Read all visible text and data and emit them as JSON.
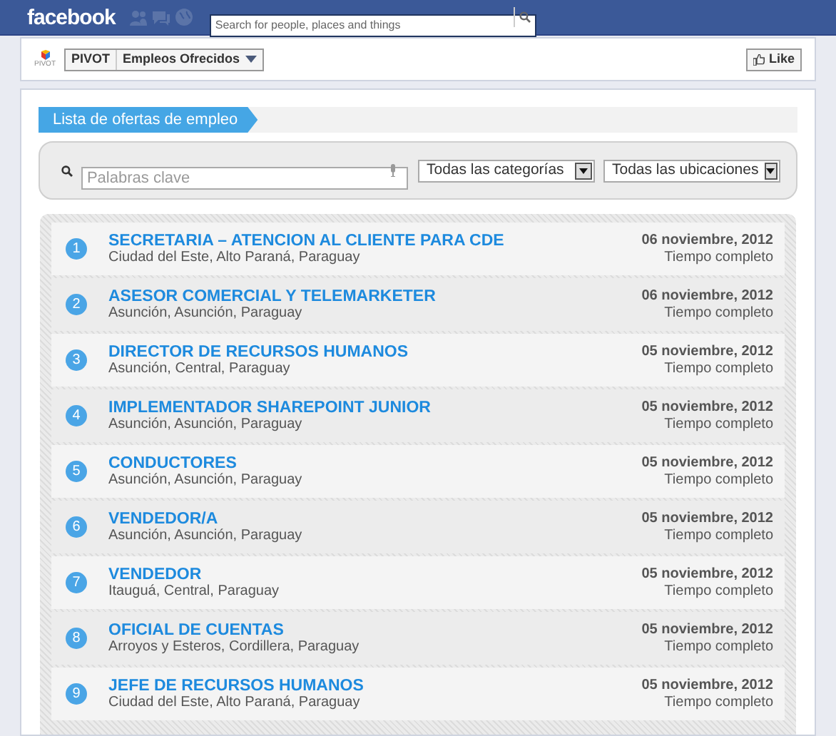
{
  "topbar": {
    "logo": "facebook",
    "search": {
      "placeholder": "Search for people, places and things"
    }
  },
  "page_header": {
    "brand": "PIVOT",
    "breadcrumb": [
      "PIVOT",
      "Empleos Ofrecidos"
    ],
    "like_button": "Like"
  },
  "section_title": "Lista de ofertas de empleo",
  "filters": {
    "keywords": {
      "placeholder": "Palabras clave"
    },
    "category": "Todas las categorías",
    "location": "Todas las ubicaciones"
  },
  "jobs": [
    {
      "number": "1",
      "title": "SECRETARIA – ATENCION AL CLIENTE PARA CDE",
      "location": "Ciudad del Este, Alto Paraná, Paraguay",
      "date": "06 noviembre, 2012",
      "type": "Tiempo completo"
    },
    {
      "number": "2",
      "title": "ASESOR COMERCIAL Y TELEMARKETER",
      "location": "Asunción, Asunción, Paraguay",
      "date": "06 noviembre, 2012",
      "type": "Tiempo completo"
    },
    {
      "number": "3",
      "title": "DIRECTOR DE RECURSOS HUMANOS",
      "location": "Asunción, Central, Paraguay",
      "date": "05 noviembre, 2012",
      "type": "Tiempo completo"
    },
    {
      "number": "4",
      "title": "IMPLEMENTADOR SHAREPOINT JUNIOR",
      "location": "Asunción, Asunción, Paraguay",
      "date": "05 noviembre, 2012",
      "type": "Tiempo completo"
    },
    {
      "number": "5",
      "title": "CONDUCTORES",
      "location": "Asunción, Asunción, Paraguay",
      "date": "05 noviembre, 2012",
      "type": "Tiempo completo"
    },
    {
      "number": "6",
      "title": "VENDEDOR/A",
      "location": "Asunción, Asunción, Paraguay",
      "date": "05 noviembre, 2012",
      "type": "Tiempo completo"
    },
    {
      "number": "7",
      "title": "VENDEDOR",
      "location": "Itauguá, Central, Paraguay",
      "date": "05 noviembre, 2012",
      "type": "Tiempo completo"
    },
    {
      "number": "8",
      "title": "OFICIAL DE CUENTAS",
      "location": "Arroyos y Esteros, Cordillera, Paraguay",
      "date": "05 noviembre, 2012",
      "type": "Tiempo completo"
    },
    {
      "number": "9",
      "title": "JEFE DE RECURSOS HUMANOS",
      "location": "Ciudad del Este, Alto Paraná, Paraguay",
      "date": "05 noviembre, 2012",
      "type": "Tiempo completo"
    }
  ]
}
